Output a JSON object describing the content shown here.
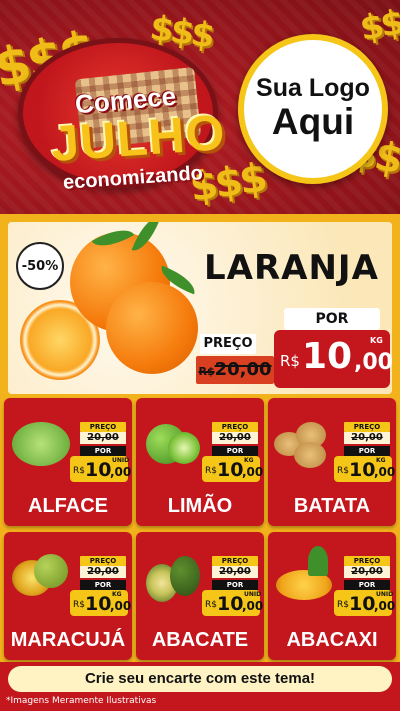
{
  "header": {
    "headline_line1": "Comece",
    "headline_line2": "JULHO",
    "headline_line3": "economizando",
    "dollar_sign": "$$$",
    "logo_line1": "Sua Logo",
    "logo_line2": "Aqui"
  },
  "hero": {
    "discount": "-50%",
    "product": "LARANJA",
    "preco_label": "PREÇO",
    "old_currency": "R$",
    "old_price": "20,00",
    "por_label": "POR",
    "currency": "R$",
    "price_int": "10",
    "price_dec": ",00",
    "unit": "KG"
  },
  "cards": [
    {
      "name": "ALFACE",
      "preco_label": "PREÇO",
      "old_price": "20,00",
      "por_label": "POR",
      "currency": "R$",
      "price_int": "10",
      "price_dec": ",00",
      "unit": "UNID"
    },
    {
      "name": "LIMÃO",
      "preco_label": "PREÇO",
      "old_price": "20,00",
      "por_label": "POR",
      "currency": "R$",
      "price_int": "10",
      "price_dec": ",00",
      "unit": "KG"
    },
    {
      "name": "BATATA",
      "preco_label": "PREÇO",
      "old_price": "20,00",
      "por_label": "POR",
      "currency": "R$",
      "price_int": "10",
      "price_dec": ",00",
      "unit": "KG"
    },
    {
      "name": "MARACUJÁ",
      "preco_label": "PREÇO",
      "old_price": "20,00",
      "por_label": "POR",
      "currency": "R$",
      "price_int": "10",
      "price_dec": ",00",
      "unit": "KG"
    },
    {
      "name": "ABACATE",
      "preco_label": "PREÇO",
      "old_price": "20,00",
      "por_label": "POR",
      "currency": "R$",
      "price_int": "10",
      "price_dec": ",00",
      "unit": "UNID"
    },
    {
      "name": "ABACAXI",
      "preco_label": "PREÇO",
      "old_price": "20,00",
      "por_label": "POR",
      "currency": "R$",
      "price_int": "10",
      "price_dec": ",00",
      "unit": "UNID"
    }
  ],
  "footer": {
    "cta": "Crie seu encarte com este tema!",
    "note": "*Imagens Meramente Ilustrativas"
  },
  "colors": {
    "brand_red": "#c4171d",
    "accent_yellow": "#f5c518",
    "background_gold": "#f2b21c"
  }
}
